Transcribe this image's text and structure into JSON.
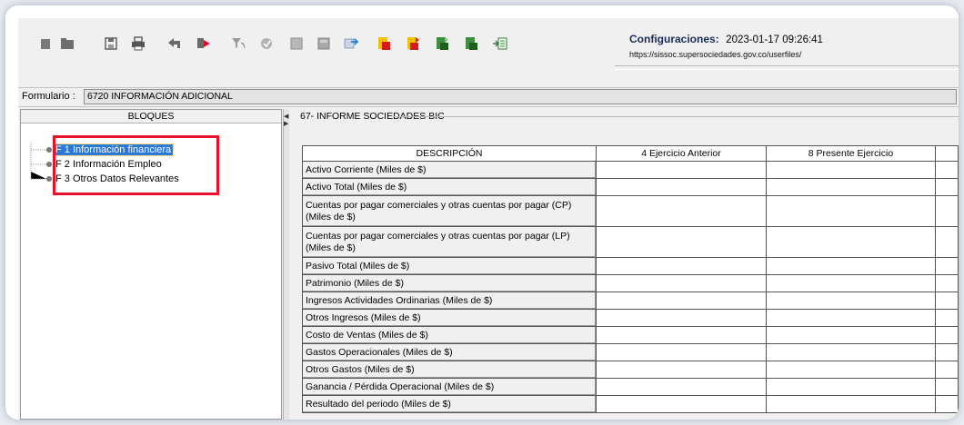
{
  "toolbar": {
    "buttons": [
      {
        "name": "new-icon"
      },
      {
        "name": "open-folder-icon"
      },
      {
        "name": "save-icon"
      },
      {
        "name": "print-icon"
      },
      {
        "name": "back-icon"
      },
      {
        "name": "forward-icon"
      },
      {
        "name": "filter-icon"
      },
      {
        "name": "check-icon"
      },
      {
        "name": "grid-icon"
      },
      {
        "name": "table-icon"
      },
      {
        "name": "import-icon"
      },
      {
        "name": "export-red-icon"
      },
      {
        "name": "export-red-2-icon"
      },
      {
        "name": "export-green-icon"
      },
      {
        "name": "export-green-2-icon"
      },
      {
        "name": "list-arrow-icon"
      }
    ],
    "config_label": "Configuraciones:",
    "config_timestamp": "2023-01-17 09:26:41",
    "config_url": "https://sissoc.supersociedades.gov.co/userfiles/"
  },
  "form": {
    "label": "Formulario :",
    "value": "6720 INFORMACIÓN ADICIONAL"
  },
  "bloques": {
    "title": "BLOQUES",
    "items": [
      {
        "label": "F 1 Información financiera",
        "selected": true
      },
      {
        "label": "F 2 Información Empleo",
        "selected": false
      },
      {
        "label": "F 3 Otros Datos Relevantes",
        "selected": false
      }
    ]
  },
  "main": {
    "title": "67- INFORME SOCIEDADES BIC",
    "columns": [
      "DESCRIPCIÓN",
      "4 Ejercicio Anterior",
      "8 Presente Ejercicio"
    ],
    "rows": [
      "Activo Corriente (Miles de $)",
      "Activo Total (Miles de $)",
      "Cuentas por pagar comerciales y otras cuentas por pagar (CP) (Miles de $)",
      "Cuentas por pagar comerciales y otras cuentas por pagar (LP) (Miles de $)",
      "Pasivo Total (Miles de $)",
      "Patrimonio (Miles de $)",
      "Ingresos Actividades Ordinarias (Miles de $)",
      "Otros Ingresos (Miles de $)",
      "Costo de Ventas (Miles de $)",
      "Gastos Operacionales (Miles de $)",
      "Otros Gastos (Miles de $)",
      "Ganancia / Pérdida Operacional (Miles de $)",
      "Resultado del periodo (Miles de $)"
    ]
  },
  "colors": {
    "selection": "#2b78d6",
    "highlight_box": "#e8102a"
  }
}
